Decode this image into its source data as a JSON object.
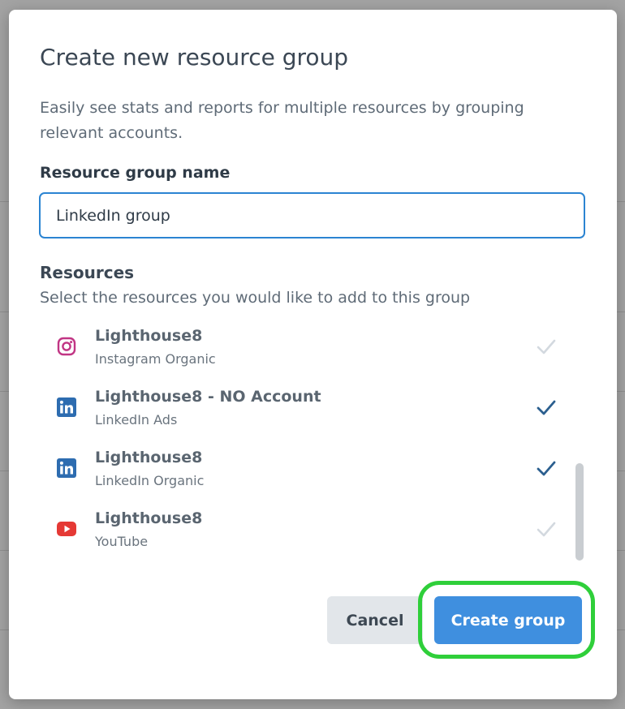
{
  "dialog": {
    "title": "Create new resource group",
    "description": "Easily see stats and reports for multiple resources by grouping relevant accounts.",
    "name_label": "Resource group name",
    "name_value": "LinkedIn group",
    "resources_label": "Resources",
    "resources_sublabel": "Select the resources you would like to add to this group",
    "resources": [
      {
        "name": "Lighthouse8",
        "type": "Instagram Organic",
        "icon": "instagram-icon",
        "selected": false
      },
      {
        "name": "Lighthouse8 - NO Account",
        "type": "LinkedIn Ads",
        "icon": "linkedin-icon",
        "selected": true
      },
      {
        "name": "Lighthouse8",
        "type": "LinkedIn Organic",
        "icon": "linkedin-icon",
        "selected": true
      },
      {
        "name": "Lighthouse8",
        "type": "YouTube",
        "icon": "youtube-icon",
        "selected": false
      }
    ],
    "cancel_label": "Cancel",
    "create_label": "Create group"
  },
  "colors": {
    "primary": "#3f8fdf",
    "check_selected": "#2b5f8f",
    "check_unselected": "#d3d9df",
    "highlight": "#2fcf3a",
    "instagram": "#c13584",
    "linkedin": "#2d6cb0",
    "youtube": "#e53935"
  }
}
